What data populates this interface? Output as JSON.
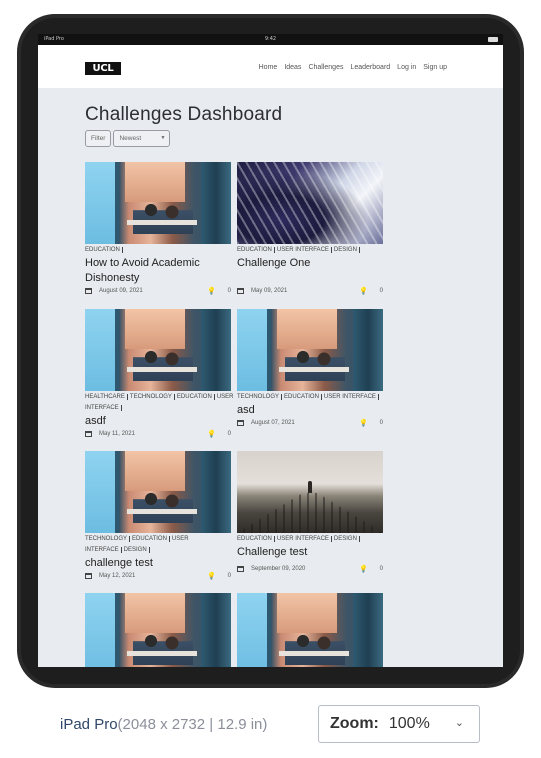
{
  "status_bar": {
    "left": "iPad Pro",
    "time": "9:42"
  },
  "nav": {
    "logo": "UCL",
    "links": [
      "Home",
      "Ideas",
      "Challenges",
      "Leaderboard",
      "Log in",
      "Sign up"
    ]
  },
  "page_title": "Challenges Dashboard",
  "filters": {
    "filter_label": "Filter",
    "sort_value": "Newest"
  },
  "cards": [
    {
      "image": "cafe",
      "tags": [
        "EDUCATION"
      ],
      "title": "How to Avoid Academic Dishonesty",
      "date": "August 09, 2021",
      "count": "0"
    },
    {
      "image": "library",
      "tags": [
        "EDUCATION",
        "USER INTERFACE",
        "DESIGN"
      ],
      "title": "Challenge One",
      "date": "May 09, 2021",
      "count": "0"
    },
    {
      "image": "cafe",
      "tags": [
        "HEALTHCARE",
        "TECHNOLOGY",
        "EDUCATION",
        "USER INTERFACE"
      ],
      "title": "asdf",
      "date": "May 11, 2021",
      "count": "0"
    },
    {
      "image": "cafe",
      "tags": [
        "TECHNOLOGY",
        "EDUCATION",
        "USER INTERFACE"
      ],
      "title": "asd",
      "date": "August 07, 2021",
      "count": "0"
    },
    {
      "image": "cafe",
      "tags": [
        "TECHNOLOGY",
        "EDUCATION",
        "USER INTERFACE",
        "DESIGN"
      ],
      "title": "challenge test",
      "date": "May 12, 2021",
      "count": "0"
    },
    {
      "image": "railway",
      "tags": [
        "EDUCATION",
        "USER INTERFACE",
        "DESIGN"
      ],
      "title": "Challenge test",
      "date": "September 09, 2020",
      "count": "0"
    },
    {
      "image": "cafe",
      "tags": [],
      "title": "",
      "date": "",
      "count": ""
    },
    {
      "image": "cafe",
      "tags": [],
      "title": "",
      "date": "",
      "count": ""
    }
  ],
  "device_caption": {
    "name": "iPad Pro",
    "dims": "(2048 x 2732 | 12.9 in)"
  },
  "zoom": {
    "label": "Zoom:",
    "value": "100%"
  }
}
